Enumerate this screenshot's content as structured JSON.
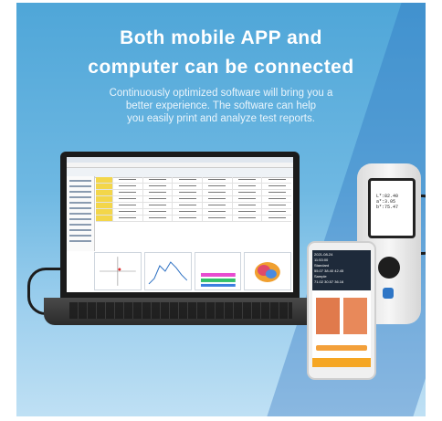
{
  "headline": {
    "line1": "Both mobile APP and",
    "line2": "computer can be connected"
  },
  "subtitle": {
    "line1": "Continuously optimized software will bring you a",
    "line2": "better experience. The software can help",
    "line3": "you easily print and analyze test reports."
  },
  "device_readout": {
    "l": "L*:82.40",
    "a": "a*:3.05",
    "b": "b*:75.47"
  },
  "phone_readout": {
    "date": "2021-08-24",
    "time": "11:53:00",
    "standard_label": "Standard",
    "standard_values": "55.07  38.40  42.45",
    "sample_label": "Sample",
    "sample_values": "71.02  30.57  36.16"
  },
  "colors": {
    "background_top": "#4fa6d8",
    "background_bottom": "#bfe0f4",
    "accent_orange": "#f5a623"
  }
}
